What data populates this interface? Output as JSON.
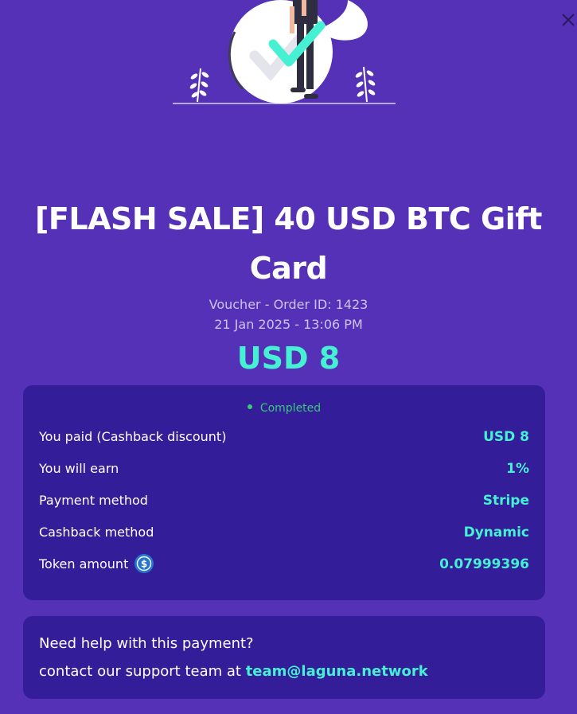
{
  "order": {
    "title": "[FLASH SALE] 40 USD BTC Gift Card",
    "voucher_line": "Voucher - Order ID: 1423",
    "date_line": "21 Jan 2025 - 13:06 PM",
    "amount": "USD 8"
  },
  "details": {
    "status": "Completed",
    "rows": [
      {
        "label": "You paid (Cashback discount)",
        "value": "USD 8"
      },
      {
        "label": "You will earn",
        "value": "1%"
      },
      {
        "label": "Payment method",
        "value": "Stripe"
      },
      {
        "label": "Cashback method",
        "value": "Dynamic"
      },
      {
        "label": "Token amount",
        "value": "0.07999396",
        "icon": "usdc-coin-icon"
      }
    ]
  },
  "help": {
    "line1": "Need help with this payment?",
    "line2_prefix": "contact our support team at ",
    "email": "team@laguna.network"
  },
  "icons": {
    "close": "close-icon",
    "status": "status-dot-icon",
    "illustration": "payment-success-illustration"
  },
  "colors": {
    "background": "#5531b8",
    "card": "#331d99",
    "accent": "#46f0d2",
    "status": "#38c97a",
    "muted_text": "#cfc2ee"
  }
}
